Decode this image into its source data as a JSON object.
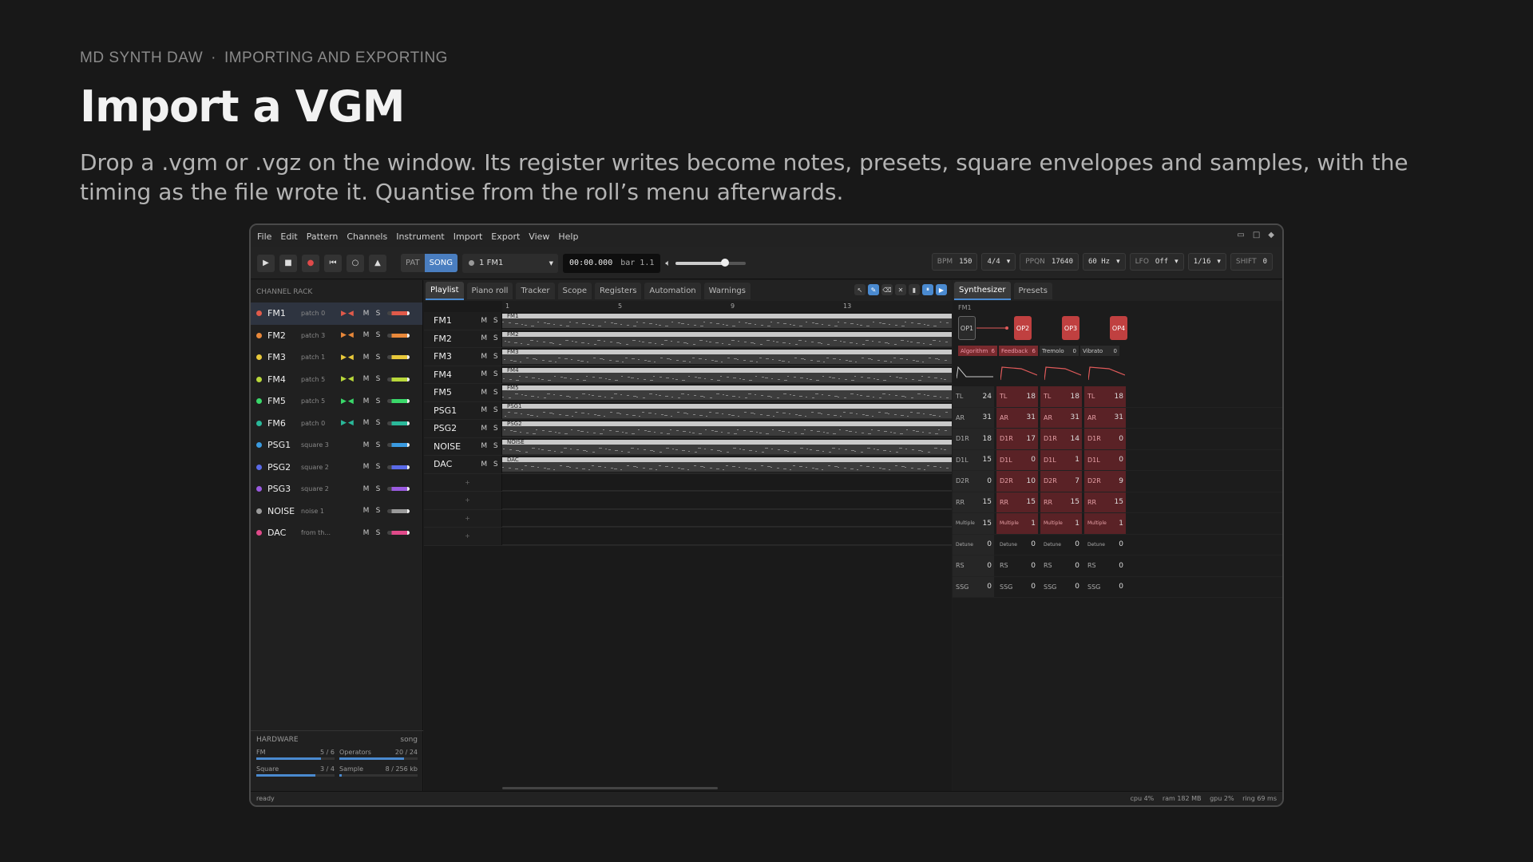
{
  "hero": {
    "crumb_app": "MD SYNTH DAW",
    "crumb_sep": "·",
    "crumb_section": "IMPORTING AND EXPORTING",
    "title": "Import a VGM",
    "desc": "Drop a .vgm or .vgz on the window. Its register writes become notes, presets, square envelopes and samples, with the timing as the file wrote it. Quantise from the roll’s menu afterwards."
  },
  "menu": [
    "File",
    "Edit",
    "Pattern",
    "Channels",
    "Instrument",
    "Import",
    "Export",
    "View",
    "Help"
  ],
  "transport": {
    "pat": "PAT",
    "song": "SONG",
    "channel": "1  FM1",
    "time": "00:00.000",
    "bar": "bar 1.1",
    "volume": 0.7
  },
  "params": [
    {
      "k": "BPM",
      "v": "150"
    },
    {
      "k": "",
      "v": "4/4"
    },
    {
      "k": "PPQN",
      "v": "17640"
    },
    {
      "k": "",
      "v": "60 Hz"
    },
    {
      "k": "LFO",
      "v": "Off"
    },
    {
      "k": "",
      "v": "1/16"
    },
    {
      "k": "SHIFT",
      "v": "0"
    }
  ],
  "rack": {
    "title": "CHANNEL RACK",
    "channels": [
      {
        "name": "FM1",
        "patch": "patch 0",
        "color": "#e05a4a",
        "sel": true,
        "fm": true
      },
      {
        "name": "FM2",
        "patch": "patch 3",
        "color": "#e8883a",
        "fm": true
      },
      {
        "name": "FM3",
        "patch": "patch 1",
        "color": "#e8c83a",
        "fm": true
      },
      {
        "name": "FM4",
        "patch": "patch 5",
        "color": "#b8d83a",
        "fm": true
      },
      {
        "name": "FM5",
        "patch": "patch 5",
        "color": "#3ad86a",
        "fm": true
      },
      {
        "name": "FM6",
        "patch": "patch 0",
        "color": "#2ab89a",
        "fm": true
      },
      {
        "name": "PSG1",
        "patch": "square 3",
        "color": "#3a9ae0"
      },
      {
        "name": "PSG2",
        "patch": "square 2",
        "color": "#5a6ae8"
      },
      {
        "name": "PSG3",
        "patch": "square 2",
        "color": "#9a5ae0"
      },
      {
        "name": "NOISE",
        "patch": "noise 1",
        "color": "#9a9a9a"
      },
      {
        "name": "DAC",
        "patch": "from th...",
        "color": "#e04a8a"
      }
    ]
  },
  "hardware": {
    "title": "HARDWARE",
    "mode": "song",
    "items": [
      {
        "k": "FM",
        "v": "5 / 6",
        "f": 0.83
      },
      {
        "k": "Operators",
        "v": "20 / 24",
        "f": 0.83
      },
      {
        "k": "Square",
        "v": "3 / 4",
        "f": 0.75
      },
      {
        "k": "Sample",
        "v": "8 / 256 kb",
        "f": 0.03
      }
    ]
  },
  "tabs": [
    "Playlist",
    "Piano roll",
    "Tracker",
    "Scope",
    "Registers",
    "Automation",
    "Warnings"
  ],
  "ruler": [
    "1",
    "5",
    "9",
    "13"
  ],
  "tracks": [
    "FM1",
    "FM2",
    "FM3",
    "FM4",
    "FM5",
    "PSG1",
    "PSG2",
    "NOISE",
    "DAC"
  ],
  "synth": {
    "tabs": [
      "Synthesizer",
      "Presets"
    ],
    "channel": "FM1",
    "ops": [
      "OP1",
      "OP2",
      "OP3",
      "OP4"
    ],
    "knobs": [
      {
        "k": "Algorithm",
        "v": "6",
        "red": true
      },
      {
        "k": "Feedback",
        "v": "6",
        "red": true
      },
      {
        "k": "Tremolo",
        "v": "0"
      },
      {
        "k": "Vibrato",
        "v": "0"
      }
    ],
    "rows": [
      {
        "k": "TL",
        "v": [
          "24",
          "18",
          "18",
          "18"
        ]
      },
      {
        "k": "AR",
        "v": [
          "31",
          "31",
          "31",
          "31"
        ]
      },
      {
        "k": "D1R",
        "v": [
          "18",
          "17",
          "14",
          "0"
        ]
      },
      {
        "k": "D1L",
        "v": [
          "15",
          "0",
          "1",
          "0"
        ]
      },
      {
        "k": "D2R",
        "v": [
          "0",
          "10",
          "7",
          "9"
        ]
      },
      {
        "k": "RR",
        "v": [
          "15",
          "15",
          "15",
          "15"
        ]
      },
      {
        "k": "Multiple",
        "v": [
          "15",
          "1",
          "1",
          "1"
        ]
      },
      {
        "k": "Detune",
        "v": [
          "0",
          "0",
          "0",
          "0"
        ]
      },
      {
        "k": "RS",
        "v": [
          "0",
          "0",
          "0",
          "0"
        ]
      },
      {
        "k": "SSG",
        "v": [
          "0",
          "0",
          "0",
          "0"
        ]
      }
    ]
  },
  "status": {
    "left": "ready",
    "cpu": "cpu 4%",
    "ram": "ram 182 MB",
    "gpu": "gpu 2%",
    "ring": "ring 69 ms"
  }
}
